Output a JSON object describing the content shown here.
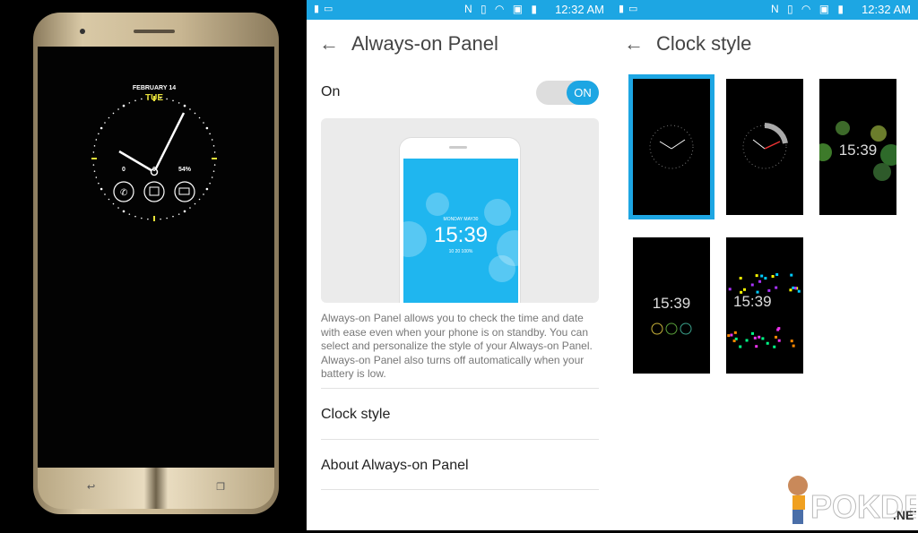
{
  "photo": {
    "clock": {
      "date": "FEBRUARY 14",
      "day": "TUE",
      "calls": "0",
      "messages": "0",
      "battery": "54%"
    }
  },
  "status_bar": {
    "time": "12:32 AM",
    "icons": [
      "gallery-icon",
      "image-icon",
      "nfc-icon",
      "vibrate-icon",
      "wifi-icon",
      "sd-icon",
      "battery-icon"
    ]
  },
  "always_on": {
    "title": "Always-on Panel",
    "toggle_label": "On",
    "toggle_state": "ON",
    "preview": {
      "date": "MONDAY MAY30",
      "time": "15:39",
      "stats": "10  20  100%"
    },
    "description": "Always-on Panel allows you to check the time and date with ease even when your phone is on standby. You can select and personalize the style of your Always-on Panel. Always-on Panel also turns off automatically when your battery is low.",
    "items": [
      {
        "label": "Clock style"
      },
      {
        "label": "About Always-on Panel"
      }
    ]
  },
  "clock_style": {
    "title": "Clock style",
    "selected_index": 0,
    "styles": [
      {
        "time": ""
      },
      {
        "time": ""
      },
      {
        "time": "15:39"
      },
      {
        "time": "15:39"
      },
      {
        "time": "15:39"
      }
    ]
  },
  "accent": "#1da6e3",
  "watermark": {
    "text": "POKDE.NET"
  }
}
